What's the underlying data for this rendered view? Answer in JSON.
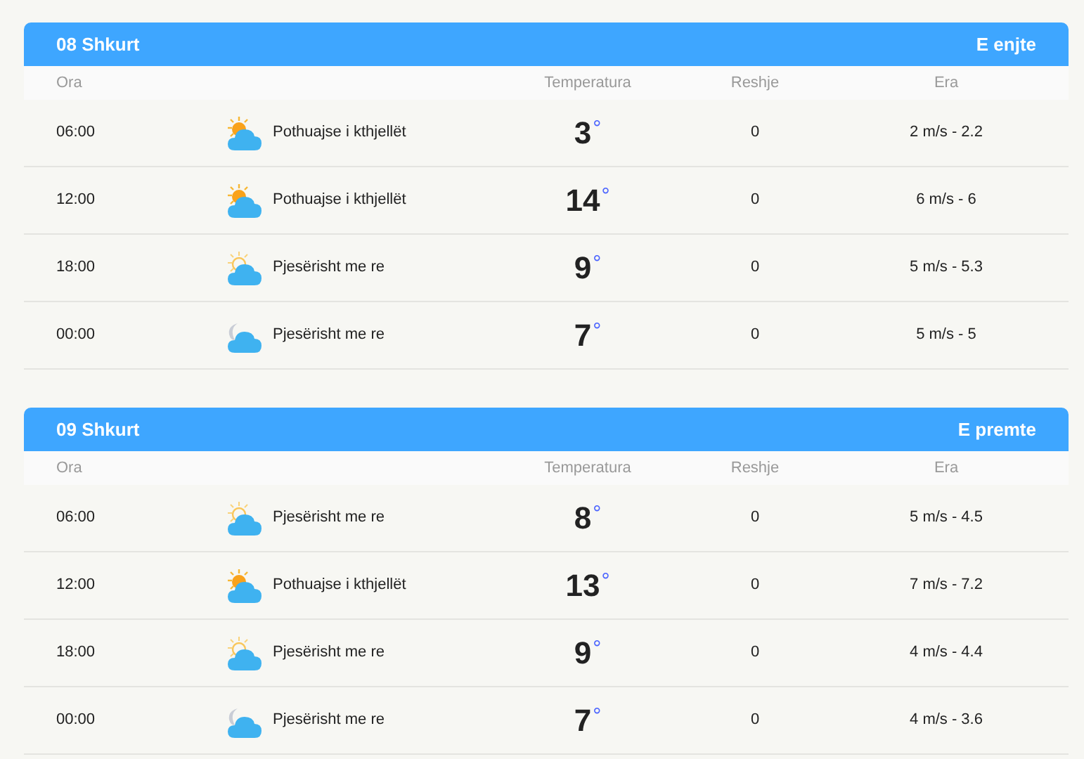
{
  "days": [
    {
      "date": "08 Shkurt",
      "weekday": "E enjte",
      "columns": [
        "Ora",
        "Temperatura",
        "Reshje",
        "Era"
      ],
      "rows": [
        {
          "time": "06:00",
          "kind": "sunny",
          "condition": "Pothuajse i kthjellët",
          "temperature": "3",
          "degree": "°",
          "precipitation": "0",
          "wind": "2 m/s - 2.2"
        },
        {
          "time": "12:00",
          "kind": "sunny",
          "condition": "Pothuajse i kthjellët",
          "temperature": "14",
          "degree": "°",
          "precipitation": "0",
          "wind": "6 m/s - 6"
        },
        {
          "time": "18:00",
          "kind": "hazy",
          "condition": "Pjesërisht me re",
          "temperature": "9",
          "degree": "°",
          "precipitation": "0",
          "wind": "5 m/s - 5.3"
        },
        {
          "time": "00:00",
          "kind": "night",
          "condition": "Pjesërisht me re",
          "temperature": "7",
          "degree": "°",
          "precipitation": "0",
          "wind": "5 m/s - 5"
        }
      ]
    },
    {
      "date": "09 Shkurt",
      "weekday": "E premte",
      "columns": [
        "Ora",
        "Temperatura",
        "Reshje",
        "Era"
      ],
      "rows": [
        {
          "time": "06:00",
          "kind": "hazy",
          "condition": "Pjesërisht me re",
          "temperature": "8",
          "degree": "°",
          "precipitation": "0",
          "wind": "5 m/s - 4.5"
        },
        {
          "time": "12:00",
          "kind": "sunny",
          "condition": "Pothuajse i kthjellët",
          "temperature": "13",
          "degree": "°",
          "precipitation": "0",
          "wind": "7 m/s - 7.2"
        },
        {
          "time": "18:00",
          "kind": "hazy",
          "condition": "Pjesërisht me re",
          "temperature": "9",
          "degree": "°",
          "precipitation": "0",
          "wind": "4 m/s - 4.4"
        },
        {
          "time": "00:00",
          "kind": "night",
          "condition": "Pjesërisht me re",
          "temperature": "7",
          "degree": "°",
          "precipitation": "0",
          "wind": "4 m/s - 3.6"
        }
      ]
    }
  ]
}
